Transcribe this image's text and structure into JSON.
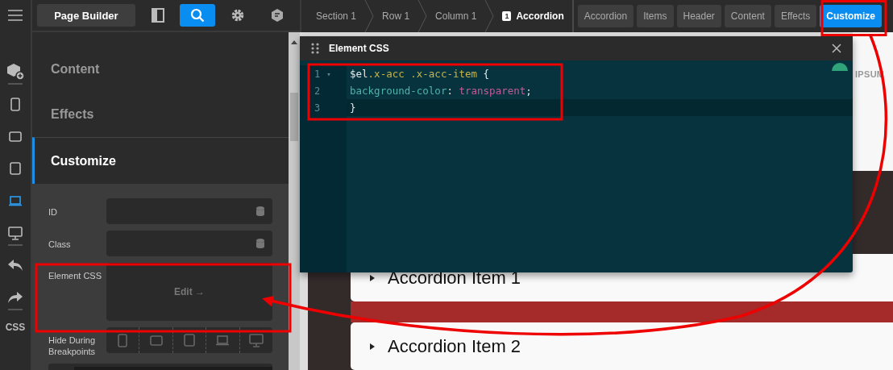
{
  "rail": {
    "groups": [
      [
        {
          "kind": "add"
        }
      ],
      [
        {
          "kind": "phone",
          "selected": false
        },
        {
          "kind": "landscape",
          "selected": false
        },
        {
          "kind": "tablet",
          "selected": false
        },
        {
          "kind": "laptop",
          "selected": true
        },
        {
          "kind": "desktop",
          "selected": false
        }
      ],
      [
        {
          "kind": "undo"
        },
        {
          "kind": "redo"
        }
      ]
    ],
    "label": "CSS"
  },
  "app_bar": {
    "title": "Page Builder",
    "tools": [
      {
        "kind": "layout",
        "selected": false
      },
      {
        "kind": "search",
        "selected": true
      },
      {
        "kind": "settings",
        "selected": false
      },
      {
        "kind": "chat",
        "selected": false
      }
    ]
  },
  "panel": {
    "sections": [
      {
        "label": "Content",
        "selected": false
      },
      {
        "label": "Effects",
        "selected": false
      },
      {
        "label": "Customize",
        "selected": true
      }
    ],
    "fields": [
      {
        "label": "ID",
        "kind": "input"
      },
      {
        "label": "Class",
        "kind": "input"
      },
      {
        "label": "Element CSS",
        "kind": "editor",
        "action": "Edit →"
      },
      {
        "label": "Hide During Breakpoints",
        "kind": "breakpoints"
      }
    ]
  },
  "breadcrumbs": [
    {
      "label": "Section 1"
    },
    {
      "label": "Row 1"
    },
    {
      "label": "Column 1"
    },
    {
      "label": "Accordion",
      "badge": "1"
    }
  ],
  "tabs": [
    {
      "label": "Accordion",
      "selected": false
    },
    {
      "label": "Items",
      "selected": false
    },
    {
      "label": "Header",
      "selected": false
    },
    {
      "label": "Content",
      "selected": false
    },
    {
      "label": "Effects",
      "selected": false
    },
    {
      "label": "Customize",
      "selected": true
    }
  ],
  "modal": {
    "title": "Element CSS",
    "lines": [
      {
        "number": "1",
        "fold": "▾",
        "active": false,
        "tokens": [
          {
            "kind": "variable",
            "text": "$el"
          },
          {
            "kind": "selector",
            "text": ".x-acc .x-acc-item"
          },
          {
            "kind": "punct",
            "text": " {"
          }
        ]
      },
      {
        "number": "2",
        "active": false,
        "tokens": [
          {
            "kind": "property",
            "text": "background-color"
          },
          {
            "kind": "punct",
            "text": ": "
          },
          {
            "kind": "value",
            "text": "transparent"
          },
          {
            "kind": "punct",
            "text": ";"
          }
        ]
      },
      {
        "number": "3",
        "active": true,
        "tokens": [
          {
            "kind": "punct",
            "text": "}"
          }
        ]
      }
    ]
  },
  "preview": {
    "heading": "IPSUM",
    "accordion": [
      {
        "label": "Accordion Item 1"
      },
      {
        "label": "Accordion Item 2"
      }
    ]
  }
}
